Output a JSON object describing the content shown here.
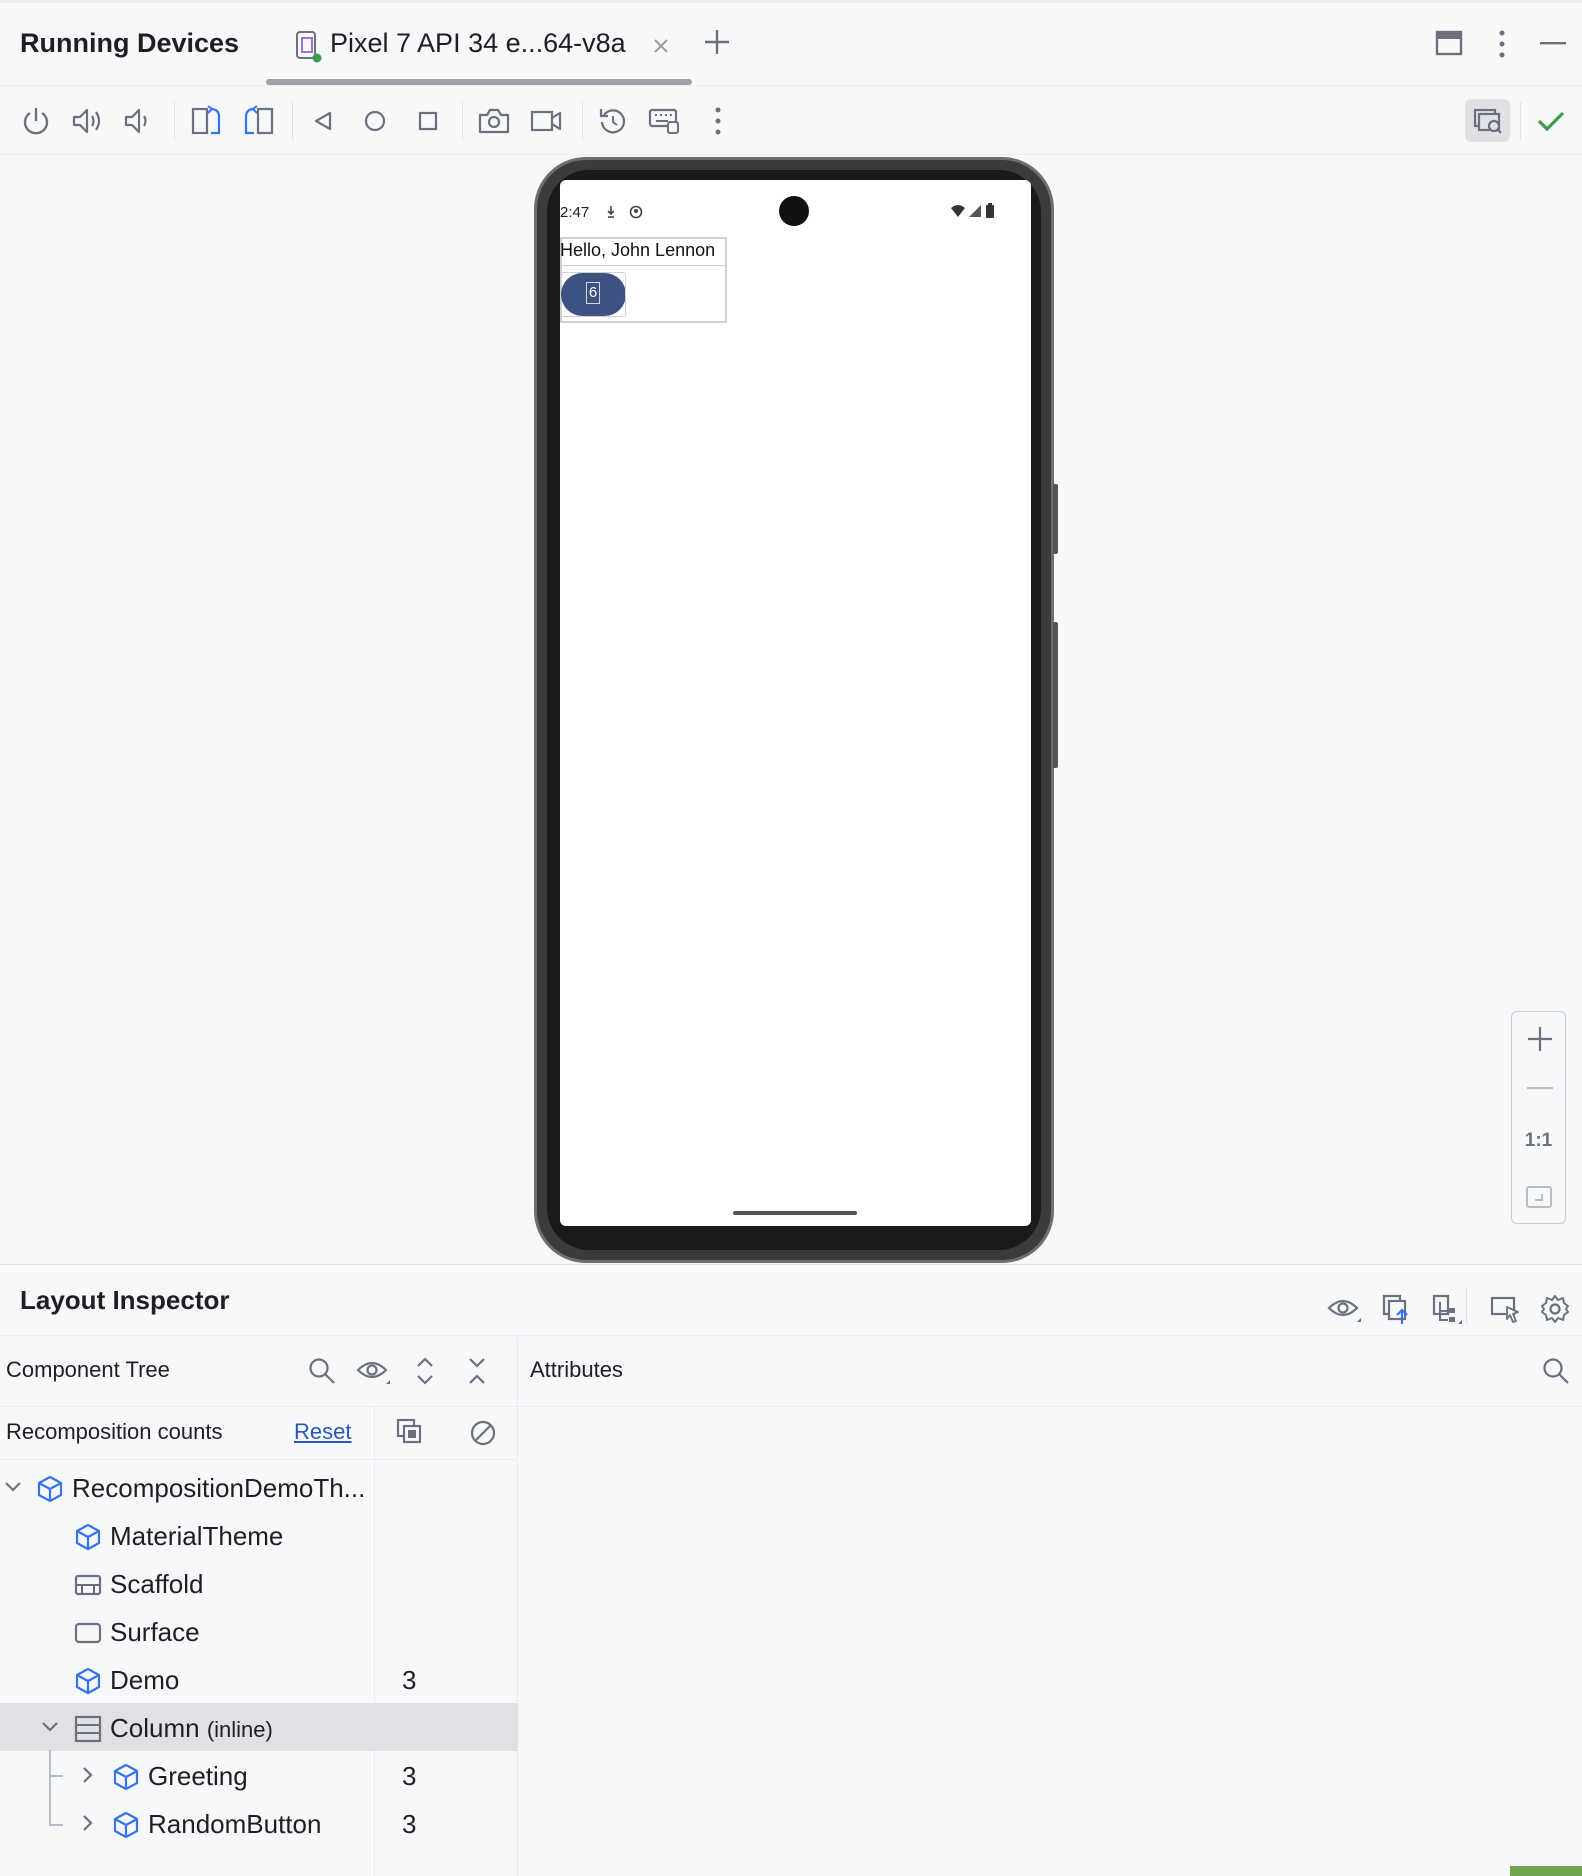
{
  "window": {
    "title": "Running Devices",
    "device_tab_label": "Pixel 7 API 34 e...64-v8a"
  },
  "colors": {
    "accent_blue": "#3574f0",
    "status_green": "#3f9b4c",
    "device_button": "#3d5280",
    "selection_bg": "#dfe1e5"
  },
  "toolbar": {
    "icons": [
      "power-icon",
      "volume-up-icon",
      "volume-down-icon",
      "rotate-left-icon",
      "rotate-right-icon",
      "back-icon",
      "home-icon",
      "overview-icon",
      "screenshot-icon",
      "screen-record-icon",
      "reset-icon",
      "keyboard-icon",
      "more-icon",
      "layout-inspector-toggle-icon",
      "check-icon"
    ]
  },
  "device_screen": {
    "status_time": "2:47",
    "greeting": "Hello, John Lennon",
    "button_value": "6"
  },
  "zoom": {
    "actual_size_label": "1:1"
  },
  "layout_inspector": {
    "title": "Layout Inspector",
    "component_tree_title": "Component Tree",
    "attributes_title": "Attributes",
    "recomposition_counts_label": "Recomposition counts",
    "reset_label": "Reset",
    "tree": [
      {
        "label": "RecompositionDemoTh...",
        "suffix": "",
        "count": "",
        "expanded": true
      },
      {
        "label": "MaterialTheme",
        "suffix": "",
        "count": ""
      },
      {
        "label": "Scaffold",
        "suffix": "",
        "count": ""
      },
      {
        "label": "Surface",
        "suffix": "",
        "count": ""
      },
      {
        "label": "Demo",
        "suffix": "",
        "count": "3"
      },
      {
        "label": "Column",
        "suffix": "(inline)",
        "count": "",
        "expanded": true,
        "selected": true
      },
      {
        "label": "Greeting",
        "suffix": "",
        "count": "3",
        "expanded": false
      },
      {
        "label": "RandomButton",
        "suffix": "",
        "count": "3",
        "expanded": false
      }
    ]
  }
}
